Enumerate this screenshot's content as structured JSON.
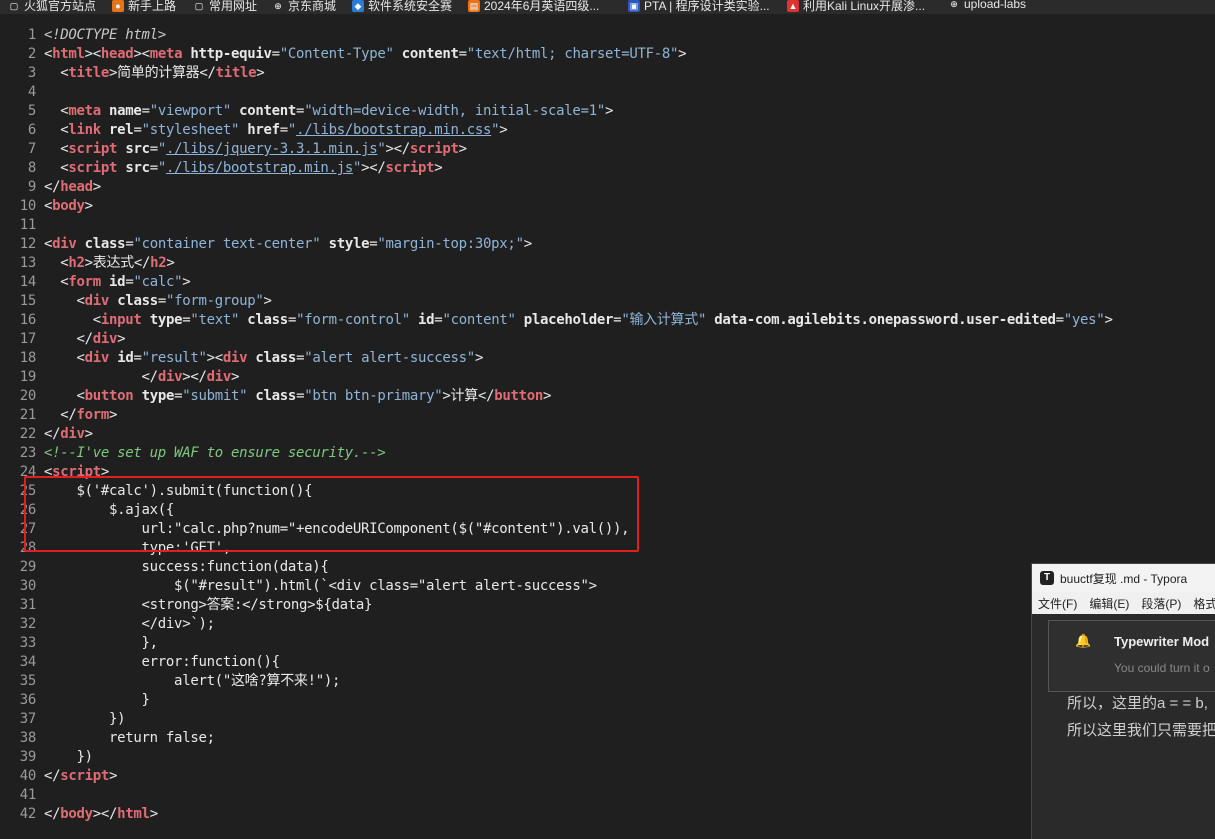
{
  "bookmarks": [
    {
      "label": "火狐官方站点",
      "icon": "page-icon"
    },
    {
      "label": "新手上路",
      "icon": "firefox-icon"
    },
    {
      "label": "常用网址",
      "icon": "page-icon"
    },
    {
      "label": "京东商城",
      "icon": "globe-icon"
    },
    {
      "label": "软件系统安全赛",
      "icon": "shield-icon"
    },
    {
      "label": "2024年6月英语四级...",
      "icon": "doc-icon"
    },
    {
      "label": "PTA | 程序设计类实验...",
      "icon": "pta-icon"
    },
    {
      "label": "利用Kali Linux开展渗...",
      "icon": "kali-icon"
    },
    {
      "label": "upload-labs",
      "icon": "globe-icon"
    }
  ],
  "code": {
    "lines": [
      [
        [
          "<!DOCTYPE html>",
          "doc"
        ]
      ],
      [
        [
          "<",
          "txt"
        ],
        [
          "html",
          "tag"
        ],
        [
          "><",
          "txt"
        ],
        [
          "head",
          "tag"
        ],
        [
          "><",
          "txt"
        ],
        [
          "meta",
          "tag"
        ],
        [
          " ",
          "txt"
        ],
        [
          "http-equiv",
          "attr"
        ],
        [
          "=",
          "txt"
        ],
        [
          "\"Content-Type\"",
          "str"
        ],
        [
          " ",
          "txt"
        ],
        [
          "content",
          "attr"
        ],
        [
          "=",
          "txt"
        ],
        [
          "\"text/html; charset=UTF-8\"",
          "str"
        ],
        [
          ">",
          "txt"
        ]
      ],
      [
        [
          "  <",
          "txt"
        ],
        [
          "title",
          "tag"
        ],
        [
          ">简单的计算器</",
          "txt"
        ],
        [
          "title",
          "tag"
        ],
        [
          ">",
          "txt"
        ]
      ],
      [],
      [
        [
          "  <",
          "txt"
        ],
        [
          "meta",
          "tag"
        ],
        [
          " ",
          "txt"
        ],
        [
          "name",
          "attr"
        ],
        [
          "=",
          "txt"
        ],
        [
          "\"viewport\"",
          "str"
        ],
        [
          " ",
          "txt"
        ],
        [
          "content",
          "attr"
        ],
        [
          "=",
          "txt"
        ],
        [
          "\"width=device-width, initial-scale=1\"",
          "str"
        ],
        [
          ">",
          "txt"
        ]
      ],
      [
        [
          "  <",
          "txt"
        ],
        [
          "link",
          "tag"
        ],
        [
          " ",
          "txt"
        ],
        [
          "rel",
          "attr"
        ],
        [
          "=",
          "txt"
        ],
        [
          "\"stylesheet\"",
          "str"
        ],
        [
          " ",
          "txt"
        ],
        [
          "href",
          "attr"
        ],
        [
          "=",
          "txt"
        ],
        [
          "\"",
          "str"
        ],
        [
          "./libs/bootstrap.min.css",
          "link"
        ],
        [
          "\"",
          "str"
        ],
        [
          ">",
          "txt"
        ]
      ],
      [
        [
          "  <",
          "txt"
        ],
        [
          "script",
          "tag"
        ],
        [
          " ",
          "txt"
        ],
        [
          "src",
          "attr"
        ],
        [
          "=",
          "txt"
        ],
        [
          "\"",
          "str"
        ],
        [
          "./libs/jquery-3.3.1.min.js",
          "link"
        ],
        [
          "\"",
          "str"
        ],
        [
          "></",
          "txt"
        ],
        [
          "script",
          "tag"
        ],
        [
          ">",
          "txt"
        ]
      ],
      [
        [
          "  <",
          "txt"
        ],
        [
          "script",
          "tag"
        ],
        [
          " ",
          "txt"
        ],
        [
          "src",
          "attr"
        ],
        [
          "=",
          "txt"
        ],
        [
          "\"",
          "str"
        ],
        [
          "./libs/bootstrap.min.js",
          "link"
        ],
        [
          "\"",
          "str"
        ],
        [
          "></",
          "txt"
        ],
        [
          "script",
          "tag"
        ],
        [
          ">",
          "txt"
        ]
      ],
      [
        [
          "</",
          "txt"
        ],
        [
          "head",
          "tag"
        ],
        [
          ">",
          "txt"
        ]
      ],
      [
        [
          "<",
          "txt"
        ],
        [
          "body",
          "tag"
        ],
        [
          ">",
          "txt"
        ]
      ],
      [],
      [
        [
          "<",
          "txt"
        ],
        [
          "div",
          "tag"
        ],
        [
          " ",
          "txt"
        ],
        [
          "class",
          "attr"
        ],
        [
          "=",
          "txt"
        ],
        [
          "\"container text-center\"",
          "str"
        ],
        [
          " ",
          "txt"
        ],
        [
          "style",
          "attr"
        ],
        [
          "=",
          "txt"
        ],
        [
          "\"margin-top:30px;\"",
          "str"
        ],
        [
          ">",
          "txt"
        ]
      ],
      [
        [
          "  <",
          "txt"
        ],
        [
          "h2",
          "tag"
        ],
        [
          ">表达式</",
          "txt"
        ],
        [
          "h2",
          "tag"
        ],
        [
          ">",
          "txt"
        ]
      ],
      [
        [
          "  <",
          "txt"
        ],
        [
          "form",
          "tag"
        ],
        [
          " ",
          "txt"
        ],
        [
          "id",
          "attr"
        ],
        [
          "=",
          "txt"
        ],
        [
          "\"calc\"",
          "str"
        ],
        [
          ">",
          "txt"
        ]
      ],
      [
        [
          "    <",
          "txt"
        ],
        [
          "div",
          "tag"
        ],
        [
          " ",
          "txt"
        ],
        [
          "class",
          "attr"
        ],
        [
          "=",
          "txt"
        ],
        [
          "\"form-group\"",
          "str"
        ],
        [
          ">",
          "txt"
        ]
      ],
      [
        [
          "      <",
          "txt"
        ],
        [
          "input",
          "tag"
        ],
        [
          " ",
          "txt"
        ],
        [
          "type",
          "attr"
        ],
        [
          "=",
          "txt"
        ],
        [
          "\"text\"",
          "str"
        ],
        [
          " ",
          "txt"
        ],
        [
          "class",
          "attr"
        ],
        [
          "=",
          "txt"
        ],
        [
          "\"form-control\"",
          "str"
        ],
        [
          " ",
          "txt"
        ],
        [
          "id",
          "attr"
        ],
        [
          "=",
          "txt"
        ],
        [
          "\"content\"",
          "str"
        ],
        [
          " ",
          "txt"
        ],
        [
          "placeholder",
          "attr"
        ],
        [
          "=",
          "txt"
        ],
        [
          "\"输入计算式\"",
          "str"
        ],
        [
          " ",
          "txt"
        ],
        [
          "data-com.agilebits.onepassword.user-edited",
          "attr"
        ],
        [
          "=",
          "txt"
        ],
        [
          "\"yes\"",
          "str"
        ],
        [
          ">",
          "txt"
        ]
      ],
      [
        [
          "    </",
          "txt"
        ],
        [
          "div",
          "tag"
        ],
        [
          ">",
          "txt"
        ]
      ],
      [
        [
          "    <",
          "txt"
        ],
        [
          "div",
          "tag"
        ],
        [
          " ",
          "txt"
        ],
        [
          "id",
          "attr"
        ],
        [
          "=",
          "txt"
        ],
        [
          "\"result\"",
          "str"
        ],
        [
          "><",
          "txt"
        ],
        [
          "div",
          "tag"
        ],
        [
          " ",
          "txt"
        ],
        [
          "class",
          "attr"
        ],
        [
          "=",
          "txt"
        ],
        [
          "\"alert alert-success\"",
          "str"
        ],
        [
          ">",
          "txt"
        ]
      ],
      [
        [
          "            </",
          "txt"
        ],
        [
          "div",
          "tag"
        ],
        [
          "></",
          "txt"
        ],
        [
          "div",
          "tag"
        ],
        [
          ">",
          "txt"
        ]
      ],
      [
        [
          "    <",
          "txt"
        ],
        [
          "button",
          "tag"
        ],
        [
          " ",
          "txt"
        ],
        [
          "type",
          "attr"
        ],
        [
          "=",
          "txt"
        ],
        [
          "\"submit\"",
          "str"
        ],
        [
          " ",
          "txt"
        ],
        [
          "class",
          "attr"
        ],
        [
          "=",
          "txt"
        ],
        [
          "\"btn btn-primary\"",
          "str"
        ],
        [
          ">计算</",
          "txt"
        ],
        [
          "button",
          "tag"
        ],
        [
          ">",
          "txt"
        ]
      ],
      [
        [
          "  </",
          "txt"
        ],
        [
          "form",
          "tag"
        ],
        [
          ">",
          "txt"
        ]
      ],
      [
        [
          "</",
          "txt"
        ],
        [
          "div",
          "tag"
        ],
        [
          ">",
          "txt"
        ]
      ],
      [
        [
          "<!--I've set up WAF to ensure security.-->",
          "com"
        ]
      ],
      [
        [
          "<",
          "txt"
        ],
        [
          "script",
          "tag"
        ],
        [
          ">",
          "txt"
        ]
      ],
      [
        [
          "    $('#calc').submit(function(){",
          "txt"
        ]
      ],
      [
        [
          "        $.ajax({",
          "txt"
        ]
      ],
      [
        [
          "            url:\"calc.php?num=\"+encodeURIComponent($(\"#content\").val()),",
          "txt"
        ]
      ],
      [
        [
          "            type:'GET',",
          "txt"
        ]
      ],
      [
        [
          "            success:function(data){",
          "txt"
        ]
      ],
      [
        [
          "                $(\"#result\").html(`<div class=\"alert alert-success\">",
          "txt"
        ]
      ],
      [
        [
          "            <strong>答案:</strong>${data}",
          "txt"
        ]
      ],
      [
        [
          "            </div>`);",
          "txt"
        ]
      ],
      [
        [
          "            },",
          "txt"
        ]
      ],
      [
        [
          "            error:function(){",
          "txt"
        ]
      ],
      [
        [
          "                alert(\"这啥?算不来!\");",
          "txt"
        ]
      ],
      [
        [
          "            }",
          "txt"
        ]
      ],
      [
        [
          "        })",
          "txt"
        ]
      ],
      [
        [
          "        return false;",
          "txt"
        ]
      ],
      [
        [
          "    })",
          "txt"
        ]
      ],
      [
        [
          "</",
          "txt"
        ],
        [
          "script",
          "tag"
        ],
        [
          ">",
          "txt"
        ]
      ],
      [],
      [
        [
          "</",
          "txt"
        ],
        [
          "body",
          "tag"
        ],
        [
          "></",
          "txt"
        ],
        [
          "html",
          "tag"
        ],
        [
          ">",
          "txt"
        ]
      ]
    ]
  },
  "typora": {
    "title": "buuctf复现 .md - Typora",
    "logo": "T",
    "menu": [
      "文件(F)",
      "编辑(E)",
      "段落(P)",
      "格式"
    ],
    "notice_title": "Typewriter Mod",
    "notice_sub": "You could turn it o",
    "para1": "所以，这里的a = = b,",
    "para2": "所以这里我们只需要把"
  }
}
